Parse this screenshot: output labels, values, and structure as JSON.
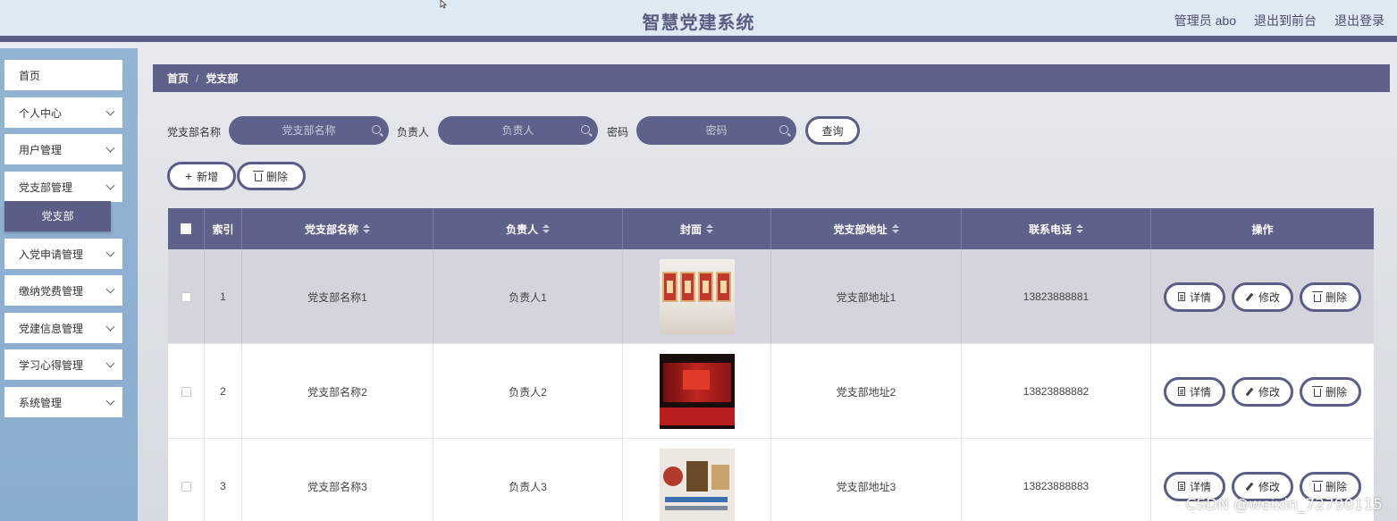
{
  "header": {
    "title": "智慧党建系统",
    "admin": "管理员 abo",
    "front": "退出到前台",
    "logout": "退出登录"
  },
  "sidebar": {
    "items": [
      {
        "label": "首页",
        "has_arrow": false
      },
      {
        "label": "个人中心",
        "has_arrow": true
      },
      {
        "label": "用户管理",
        "has_arrow": true
      },
      {
        "label": "党支部管理",
        "has_arrow": true
      },
      {
        "label": "入党申请管理",
        "has_arrow": true
      },
      {
        "label": "缴纳党费管理",
        "has_arrow": true
      },
      {
        "label": "党建信息管理",
        "has_arrow": true
      },
      {
        "label": "学习心得管理",
        "has_arrow": true
      },
      {
        "label": "系统管理",
        "has_arrow": true
      }
    ],
    "active_sub": "党支部"
  },
  "breadcrumb": {
    "home": "首页",
    "sep": "/",
    "current": "党支部"
  },
  "search": {
    "name_label": "党支部名称",
    "name_placeholder": "党支部名称",
    "leader_label": "负责人",
    "leader_placeholder": "负责人",
    "password_label": "密码",
    "password_placeholder": "密码",
    "query": "查询"
  },
  "actions": {
    "add": "新增",
    "delete": "删除"
  },
  "table": {
    "columns": [
      "索引",
      "党支部名称",
      "负责人",
      "封面",
      "党支部地址",
      "联系电话",
      "操作"
    ],
    "rows": [
      {
        "index": "1",
        "name": "党支部名称1",
        "leader": "负责人1",
        "address": "党支部地址1",
        "phone": "13823888881"
      },
      {
        "index": "2",
        "name": "党支部名称2",
        "leader": "负责人2",
        "address": "党支部地址2",
        "phone": "13823888882"
      },
      {
        "index": "3",
        "name": "党支部名称3",
        "leader": "负责人3",
        "address": "党支部地址3",
        "phone": "13823888883"
      }
    ],
    "row_actions": {
      "detail": "详情",
      "edit": "修改",
      "delete": "删除"
    }
  },
  "watermark": "CSDN @weixin_72790115",
  "colors": {
    "primary": "#5e6189",
    "sidebar": "#8fb0d2",
    "header_bg": "#dde9f3"
  }
}
